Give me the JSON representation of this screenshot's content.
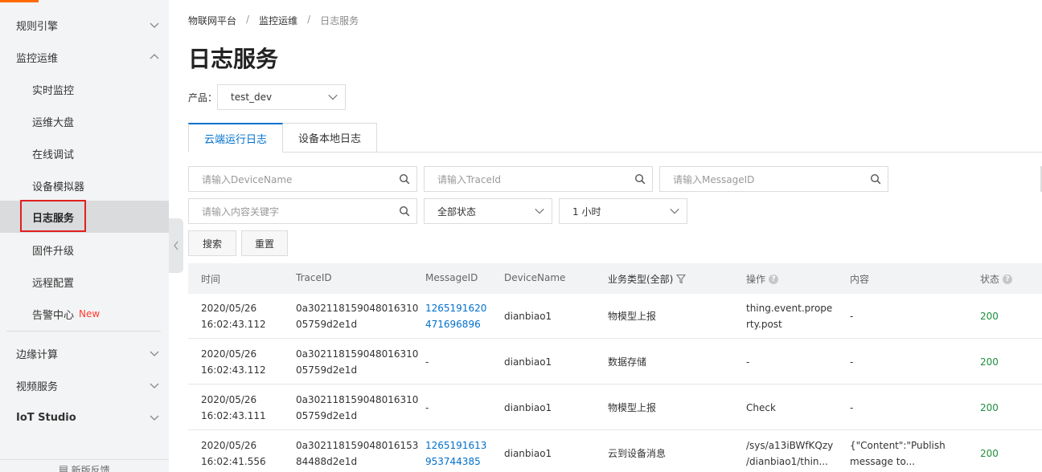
{
  "sidebar": {
    "groups": [
      {
        "label": "规则引擎"
      },
      {
        "label": "监控运维"
      },
      {
        "label": "边缘计算"
      },
      {
        "label": "视频服务"
      },
      {
        "label": "IoT Studio"
      }
    ],
    "items": [
      {
        "label": "实时监控"
      },
      {
        "label": "运维大盘"
      },
      {
        "label": "在线调试"
      },
      {
        "label": "设备模拟器"
      },
      {
        "label": "日志服务"
      },
      {
        "label": "固件升级"
      },
      {
        "label": "远程配置"
      },
      {
        "label": "告警中心",
        "badge": "New"
      }
    ],
    "feedback": "新版反馈"
  },
  "breadcrumb": {
    "items": [
      "物联网平台",
      "监控运维",
      "日志服务"
    ],
    "separator": "/"
  },
  "page_title": "日志服务",
  "product": {
    "label": "产品：",
    "value": "test_dev"
  },
  "tabs": [
    {
      "label": "云端运行日志"
    },
    {
      "label": "设备本地日志"
    }
  ],
  "filters": {
    "device_name_placeholder": "请输入DeviceName",
    "trace_id_placeholder": "请输入TraceId",
    "message_id_placeholder": "请输入MessageID",
    "keyword_placeholder": "请输入内容关键字",
    "status_value": "全部状态",
    "time_value": "1 小时",
    "search_label": "搜索",
    "reset_label": "重置"
  },
  "table": {
    "headers": [
      "时间",
      "TraceID",
      "MessageID",
      "DeviceName",
      "业务类型(全部)",
      "操作",
      "内容",
      "状态"
    ],
    "rows": [
      {
        "time1": "2020/05/26",
        "time2": "16:02:43.112",
        "trace1": "0a302118159048016310",
        "trace2": "05759d2e1d",
        "msg1": "1265191620",
        "msg2": "471696896",
        "device": "dianbiao1",
        "biz": "物模型上报",
        "op1": "thing.event.prope",
        "op2": "rty.post",
        "content1": "-",
        "content2": "",
        "status": "200"
      },
      {
        "time1": "2020/05/26",
        "time2": "16:02:43.112",
        "trace1": "0a302118159048016310",
        "trace2": "05759d2e1d",
        "msg1": "-",
        "msg2": "",
        "device": "dianbiao1",
        "biz": "数据存储",
        "op1": "-",
        "op2": "",
        "content1": "-",
        "content2": "",
        "status": "200"
      },
      {
        "time1": "2020/05/26",
        "time2": "16:02:43.111",
        "trace1": "0a302118159048016310",
        "trace2": "05759d2e1d",
        "msg1": "-",
        "msg2": "",
        "device": "dianbiao1",
        "biz": "物模型上报",
        "op1": "Check",
        "op2": "",
        "content1": "-",
        "content2": "",
        "status": "200"
      },
      {
        "time1": "2020/05/26",
        "time2": "16:02:41.556",
        "trace1": "0a302118159048016153",
        "trace2": "84488d2e1d",
        "msg1": "1265191613",
        "msg2": "953744385",
        "device": "dianbiao1",
        "biz": "云到设备消息",
        "op1": "/sys/a13iBWfKQzy",
        "op2": "/dianbiao1/thin...",
        "content1": "{\"Content\":\"Publish",
        "content2": "message to...",
        "status": "200"
      }
    ]
  },
  "colors": {
    "accent": "#0070cc",
    "status_ok": "#1e8e3e",
    "new_badge": "#ff3b30",
    "top_accent": "#ff6a00"
  }
}
